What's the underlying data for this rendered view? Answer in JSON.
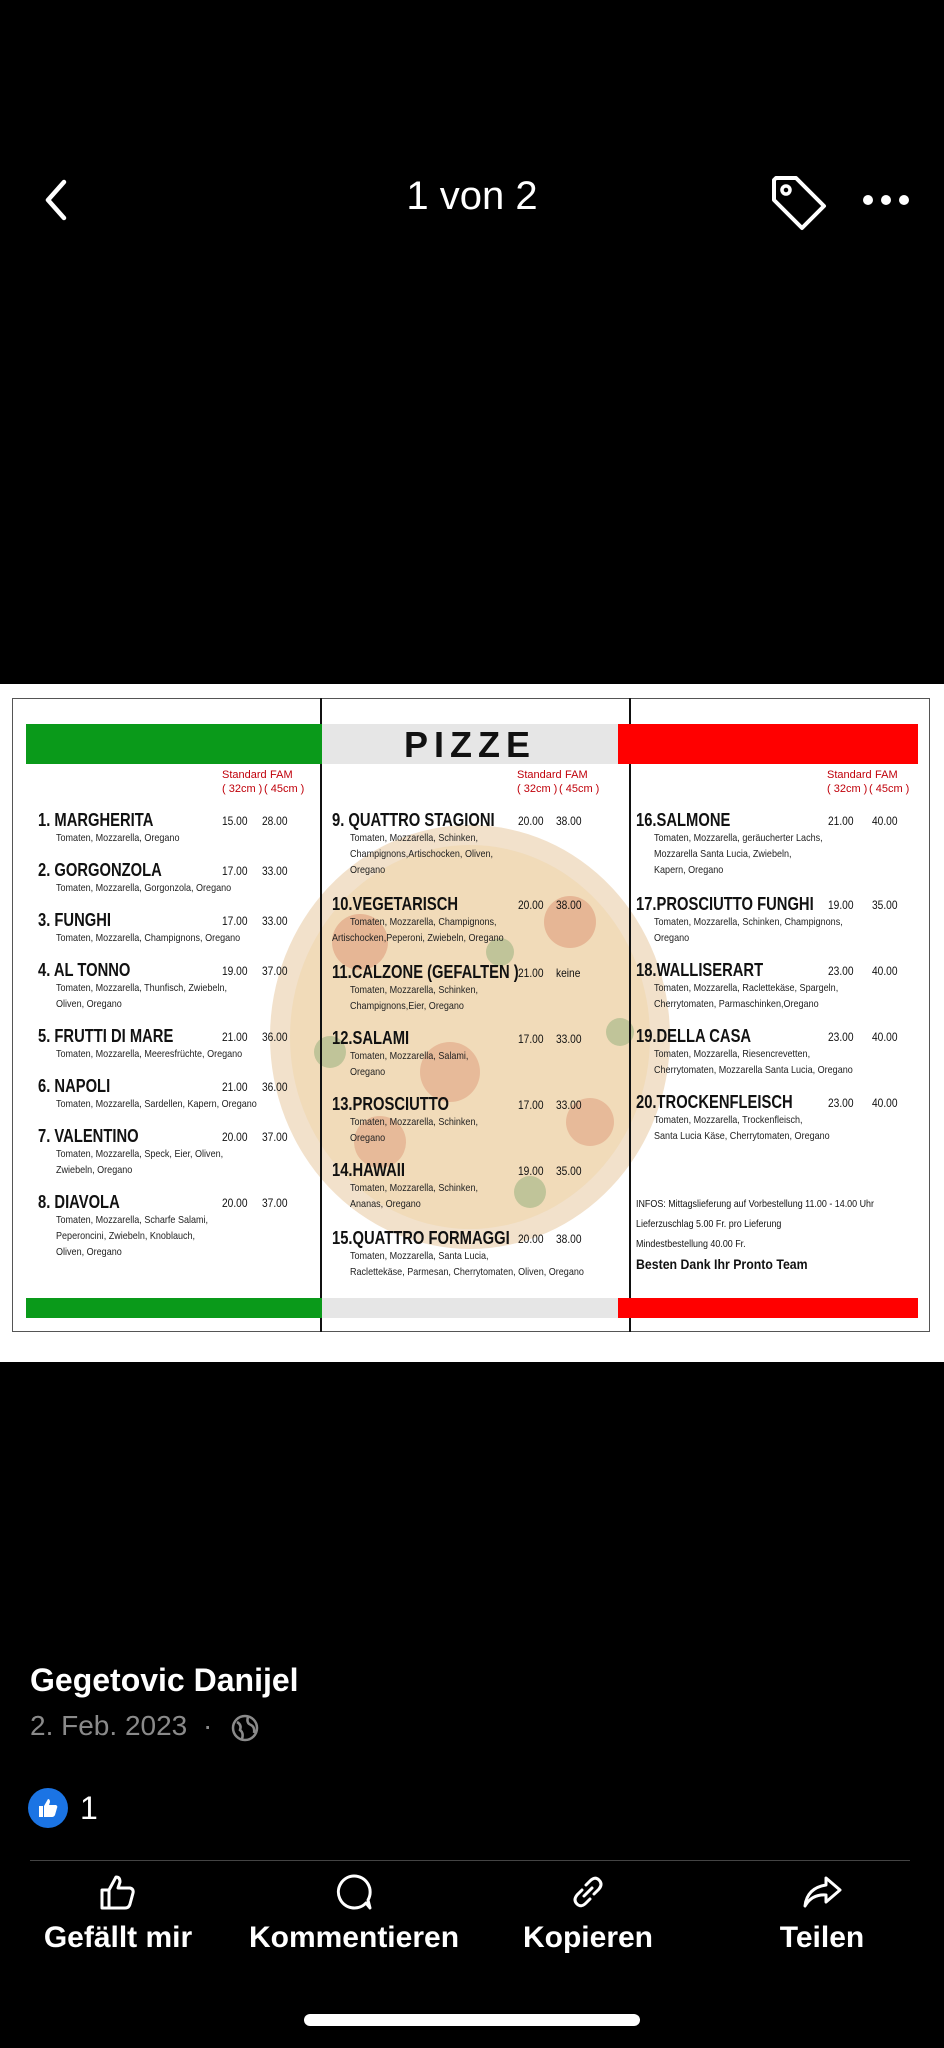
{
  "header": {
    "counter": "1 von 2"
  },
  "menu": {
    "title": "PIZZE",
    "size_std": "Standard",
    "size_std_cm": "( 32cm )",
    "size_fam": "FAM",
    "size_fam_cm": "( 45cm )",
    "col1": [
      {
        "name": "1. MARGHERITA",
        "desc": [
          "Tomaten, Mozzarella, Oregano"
        ],
        "p1": "15.00",
        "p2": "28.00"
      },
      {
        "name": "2. GORGONZOLA",
        "desc": [
          "Tomaten, Mozzarella, Gorgonzola, Oregano"
        ],
        "p1": "17.00",
        "p2": "33.00"
      },
      {
        "name": "3. FUNGHI",
        "desc": [
          "Tomaten, Mozzarella, Champignons, Oregano"
        ],
        "p1": "17.00",
        "p2": "33.00"
      },
      {
        "name": "4. AL TONNO",
        "desc": [
          "Tomaten, Mozzarella, Thunfisch, Zwiebeln,",
          "Oliven, Oregano"
        ],
        "p1": "19.00",
        "p2": "37.00"
      },
      {
        "name": "5. FRUTTI DI MARE",
        "desc": [
          "Tomaten, Mozzarella, Meeresfrüchte, Oregano"
        ],
        "p1": "21.00",
        "p2": "36.00"
      },
      {
        "name": "6. NAPOLI",
        "desc": [
          "Tomaten, Mozzarella, Sardellen, Kapern, Oregano"
        ],
        "p1": "21.00",
        "p2": "36.00"
      },
      {
        "name": "7. VALENTINO",
        "desc": [
          "Tomaten, Mozzarella, Speck, Eier, Oliven,",
          "Zwiebeln, Oregano"
        ],
        "p1": "20.00",
        "p2": "37.00"
      },
      {
        "name": "8. DIAVOLA",
        "desc": [
          "Tomaten, Mozzarella, Scharfe Salami,",
          "Peperoncini, Zwiebeln, Knoblauch,",
          "Oliven, Oregano"
        ],
        "p1": "20.00",
        "p2": "37.00"
      }
    ],
    "col2": [
      {
        "name": "9. QUATTRO STAGIONI",
        "desc": [
          "Tomaten, Mozzarella, Schinken,",
          "Champignons,Artischocken, Oliven,",
          "Oregano"
        ],
        "p1": "20.00",
        "p2": "38.00"
      },
      {
        "name": "10.VEGETARISCH",
        "desc": [
          "Tomaten, Mozzarella, Champignons,",
          "Artischocken,Peperoni, Zwiebeln, Oregano"
        ],
        "p1": "20.00",
        "p2": "38.00"
      },
      {
        "name": "11.CALZONE (GEFALTEN )",
        "desc": [
          "Tomaten, Mozzarella, Schinken,",
          "Champignons,Eier, Oregano"
        ],
        "p1": "21.00",
        "p2": "keine"
      },
      {
        "name": "12.SALAMI",
        "desc": [
          "Tomaten, Mozzarella, Salami,",
          "Oregano"
        ],
        "p1": "17.00",
        "p2": "33.00"
      },
      {
        "name": "13.PROSCIUTTO",
        "desc": [
          "Tomaten, Mozzarella, Schinken,",
          "Oregano"
        ],
        "p1": "17.00",
        "p2": "33.00"
      },
      {
        "name": "14.HAWAII",
        "desc": [
          "Tomaten, Mozzarella, Schinken,",
          "Ananas, Oregano"
        ],
        "p1": "19.00",
        "p2": "35.00"
      },
      {
        "name": "15.QUATTRO FORMAGGI",
        "desc": [
          "Tomaten, Mozzarella, Santa Lucia,",
          "Raclettekäse, Parmesan, Cherrytomaten, Oliven, Oregano"
        ],
        "p1": "20.00",
        "p2": "38.00"
      }
    ],
    "col3": [
      {
        "name": "16.SALMONE",
        "desc": [
          "Tomaten, Mozzarella, geräucherter Lachs,",
          "Mozzarella Santa Lucia, Zwiebeln,",
          "Kapern, Oregano"
        ],
        "p1": "21.00",
        "p2": "40.00"
      },
      {
        "name": "17.PROSCIUTTO FUNGHI",
        "desc": [
          "Tomaten, Mozzarella, Schinken, Champignons,",
          "Oregano"
        ],
        "p1": "19.00",
        "p2": "35.00"
      },
      {
        "name": "18.WALLISERART",
        "desc": [
          "Tomaten, Mozzarella, Raclettekäse, Spargeln,",
          "Cherrytomaten, Parmaschinken,Oregano"
        ],
        "p1": "23.00",
        "p2": "40.00"
      },
      {
        "name": "19.DELLA CASA",
        "desc": [
          "Tomaten, Mozzarella, Riesencrevetten,",
          "Cherrytomaten, Mozzarella Santa Lucia, Oregano"
        ],
        "p1": "23.00",
        "p2": "40.00"
      },
      {
        "name": "20.TROCKENFLEISCH",
        "desc": [
          "Tomaten, Mozzarella, Trockenfleisch,",
          "Santa Lucia Käse, Cherrytomaten, Oregano"
        ],
        "p1": "23.00",
        "p2": "40.00"
      }
    ],
    "info_lines": [
      "INFOS: Mittagslieferung auf Vorbestellung 11.00 - 14.00 Uhr",
      "Lieferzuschlag 5.00 Fr. pro Lieferung",
      "Mindestbestellung 40.00 Fr."
    ],
    "thanks": "Besten Dank Ihr Pronto Team"
  },
  "post": {
    "author": "Gegetovic Danijel",
    "date": "2. Feb. 2023",
    "separator": "·",
    "like_count": "1"
  },
  "actions": {
    "like": "Gefällt mir",
    "comment": "Kommentieren",
    "copy": "Kopieren",
    "share": "Teilen"
  },
  "colors": {
    "flag_green": "#0a9a1a",
    "flag_red": "#ff0000",
    "like_blue": "#1b74e4"
  }
}
